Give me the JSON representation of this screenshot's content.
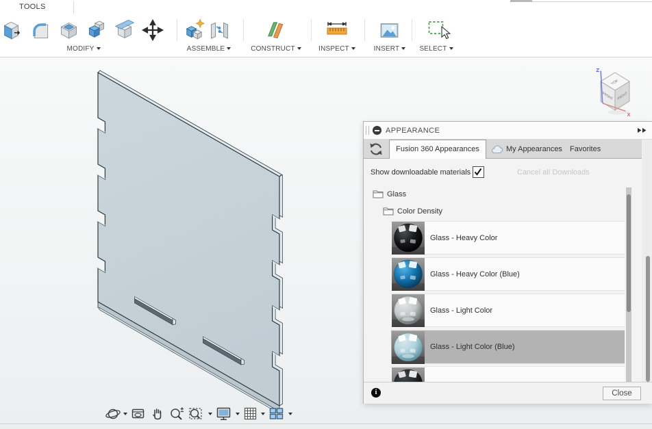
{
  "toolbar": {
    "active_tab": "TOOLS",
    "groups": [
      {
        "id": "modify",
        "label": "MODIFY"
      },
      {
        "id": "assemble",
        "label": "ASSEMBLE"
      },
      {
        "id": "construct",
        "label": "CONSTRUCT"
      },
      {
        "id": "inspect",
        "label": "INSPECT"
      },
      {
        "id": "insert",
        "label": "INSERT"
      },
      {
        "id": "select",
        "label": "SELECT"
      }
    ]
  },
  "viewcube": {
    "top": "TOP",
    "front": "FRONT",
    "right": "RIGHT",
    "axis_x": "X",
    "axis_z": "Z"
  },
  "appearance_panel": {
    "title": "APPEARANCE",
    "tabs": [
      {
        "label": "Fusion 360 Appearances",
        "active": true
      },
      {
        "label": "My Appearances",
        "active": false
      },
      {
        "label": "Favorites",
        "active": false
      }
    ],
    "show_downloadable_label": "Show downloadable materials",
    "show_downloadable_checked": true,
    "cancel_downloads_label": "Cancel all Downloads",
    "folders": [
      {
        "label": "Glass"
      },
      {
        "label": "Color Density"
      }
    ],
    "materials": [
      {
        "label": "Glass - Heavy Color",
        "selected": false,
        "sphere": {
          "light": "#4a4f55",
          "body": "#17181b",
          "dark": "#000000",
          "translucent": false
        }
      },
      {
        "label": "Glass - Heavy Color (Blue)",
        "selected": false,
        "sphere": {
          "light": "#56b2e3",
          "body": "#1273ae",
          "dark": "#073a5c",
          "translucent": false
        }
      },
      {
        "label": "Glass - Light Color",
        "selected": false,
        "sphere": {
          "light": "#f1f3f3",
          "body": "#cfd4d5",
          "dark": "#6f7678",
          "translucent": true
        }
      },
      {
        "label": "Glass - Light Color (Blue)",
        "selected": true,
        "sphere": {
          "light": "#e3f4f9",
          "body": "#b7e0ec",
          "dark": "#5f98a8",
          "translucent": true
        }
      },
      {
        "label": "",
        "selected": false,
        "sphere": {
          "light": "#3f4447",
          "body": "#24282a",
          "dark": "#050607",
          "translucent": false
        }
      }
    ],
    "close_label": "Close",
    "selected_row_color": "#b3b3b3"
  },
  "model": {
    "face_color": "#c8d3d9",
    "edge_color": "#2e3c44",
    "top_strip": "#e3ebee",
    "bottom_strip": "#b9c6cc",
    "slot_dark": "#5a6b73"
  },
  "colors": {
    "accent_blue": "#5b9fd5",
    "construct_green": "#67b76b",
    "construct_orange": "#e89a4e",
    "select_green": "#43a047",
    "measure_orange": "#f3a73a"
  }
}
